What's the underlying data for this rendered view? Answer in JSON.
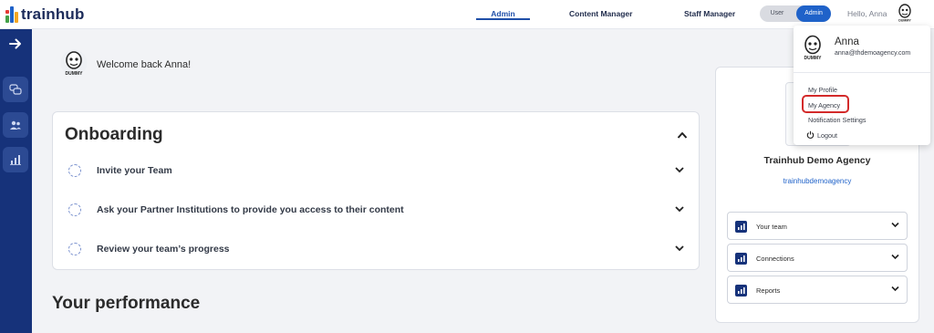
{
  "brand": {
    "name": "trainhub",
    "colors": {
      "navy": "#16327a",
      "accent": "#1f62c9",
      "highlight": "#d32a2a"
    }
  },
  "nav": {
    "items": [
      {
        "label": "Admin",
        "active": true
      },
      {
        "label": "Content Manager",
        "active": false
      },
      {
        "label": "Staff Manager",
        "active": false
      }
    ]
  },
  "role_toggle": {
    "user_label": "User",
    "admin_label": "Admin",
    "selected": "Admin"
  },
  "greeting": {
    "hello": "Hello, Anna"
  },
  "avatar": {
    "caption": "DUMMY"
  },
  "sidebar": {
    "icons": [
      "arrow-right-icon",
      "chat-icon",
      "users-icon",
      "chart-icon"
    ]
  },
  "welcome": {
    "text": "Welcome back Anna!"
  },
  "onboarding": {
    "title": "Onboarding",
    "tasks": [
      {
        "label": "Invite your Team"
      },
      {
        "label": "Ask your Partner Institutions to provide you access to their content"
      },
      {
        "label": "Review your team’s progress"
      }
    ]
  },
  "performance": {
    "title": "Your performance"
  },
  "agency": {
    "name": "Trainhub Demo Agency",
    "link": "trainhubdemoagency",
    "sections": [
      {
        "label": "Your team"
      },
      {
        "label": "Connections"
      },
      {
        "label": "Reports"
      }
    ]
  },
  "user_menu": {
    "name": "Anna",
    "email": "anna@thdemoagency.com",
    "items": [
      {
        "label": "My Profile"
      },
      {
        "label": "My Agency",
        "highlighted": true
      },
      {
        "label": "Notification Settings"
      },
      {
        "label": "Logout"
      }
    ]
  }
}
